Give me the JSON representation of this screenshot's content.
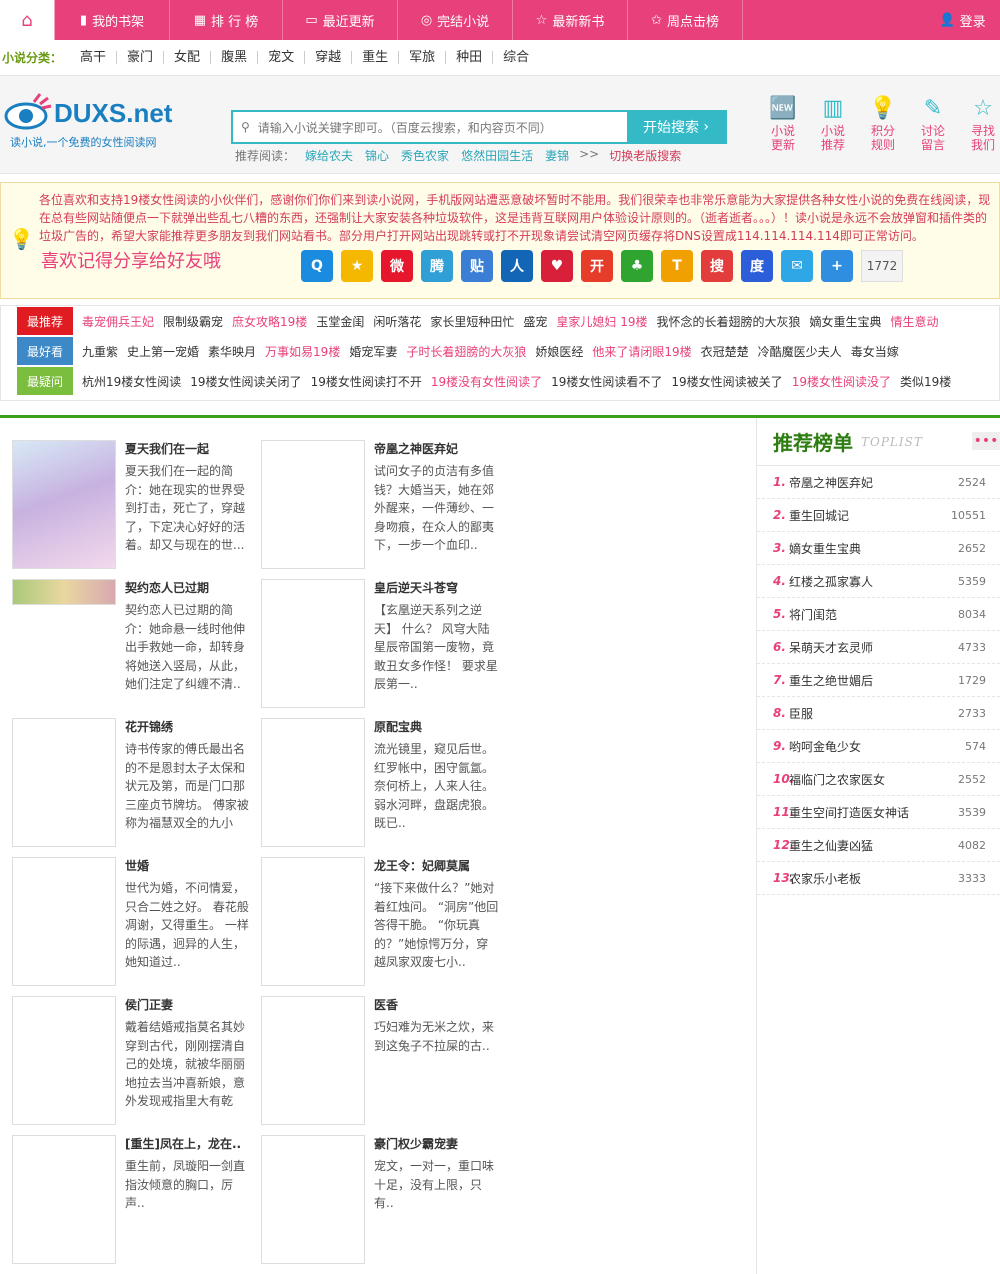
{
  "nav": {
    "home_icon": "home-icon",
    "items": [
      {
        "icon": "book-icon",
        "label": "我的书架"
      },
      {
        "icon": "list-icon",
        "label": "排 行 榜"
      },
      {
        "icon": "open-book-icon",
        "label": "最近更新"
      },
      {
        "icon": "circle-icon",
        "label": "完结小说"
      },
      {
        "icon": "star-icon",
        "label": "最新新书"
      },
      {
        "icon": "star-outline-icon",
        "label": "周点击榜"
      }
    ],
    "login": "登录"
  },
  "categories": {
    "label": "小说分类：",
    "items": [
      "高干",
      "豪门",
      "女配",
      "腹黑",
      "宠文",
      "穿越",
      "重生",
      "军旅",
      "种田",
      "综合"
    ]
  },
  "header": {
    "logo_text": "DUXS.net",
    "logo_sub": "读小说,一个免费的女性阅读网",
    "search_placeholder": "请输入小说关键字即可。（百度云搜索，和内容页不同）",
    "search_button": "开始搜索",
    "hot_label": "推荐阅读：",
    "hot": [
      "嫁给农夫",
      "锦心",
      "秀色农家",
      "悠然田园生活",
      "妻锦"
    ],
    "old_label": "切换老版搜索",
    "quick": [
      {
        "label": "小说更新",
        "icon": "new-icon"
      },
      {
        "label": "小说推荐",
        "icon": "chart-icon"
      },
      {
        "label": "积分规则",
        "icon": "bulb-icon"
      },
      {
        "label": "讨论留言",
        "icon": "pen-icon"
      },
      {
        "label": "寻找我们",
        "icon": "star-icon"
      }
    ]
  },
  "notice": {
    "text": "各位喜欢和支持19楼女性阅读的小伙伴们，感谢你们你们来到读小说网，手机版网站遭恶意破坏暂时不能用。我们很荣幸也非常乐意能为大家提供各种女性小说的免费在线阅读，现在总有些网站随便点一下就弹出些乱七八糟的东西，还强制让大家安装各种垃圾软件，这是违背互联网用户体验设计原则的。（逝者逝者。。。）！读小说是永远不会放弹窗和插件类的垃圾广告的，希望大家能推荐更多朋友到我们网站看书。部分用户打开网站出现跳转或打不开现象请尝试清空网页缓存将DNS设置成114.114.114.114即可正常访问。",
    "share_text": "喜欢记得分享给好友哦",
    "share_count": "1772"
  },
  "share_icons": [
    {
      "name": "qq-icon",
      "c": "#1b8be0",
      "g": "Q"
    },
    {
      "name": "qzone-icon",
      "c": "#f5b800",
      "g": "★"
    },
    {
      "name": "weibo-icon",
      "c": "#e6162d",
      "g": "微"
    },
    {
      "name": "tqq-icon",
      "c": "#2f9fd6",
      "g": "腾"
    },
    {
      "name": "tieba-icon",
      "c": "#3a7fd5",
      "g": "贴"
    },
    {
      "name": "renren-icon",
      "c": "#1366b6",
      "g": "人"
    },
    {
      "name": "heart-icon",
      "c": "#d8203a",
      "g": "♥"
    },
    {
      "name": "kaixin-icon",
      "c": "#e63d2a",
      "g": "开"
    },
    {
      "name": "clover-icon",
      "c": "#2fa430",
      "g": "♣"
    },
    {
      "name": "tianya-icon",
      "c": "#f0a000",
      "g": "T"
    },
    {
      "name": "sohu-icon",
      "c": "#e23c3c",
      "g": "搜"
    },
    {
      "name": "baidu-icon",
      "c": "#2d5ed9",
      "g": "度"
    },
    {
      "name": "mail-icon",
      "c": "#2fa6e6",
      "g": "✉"
    },
    {
      "name": "plus-icon",
      "c": "#2f8ee0",
      "g": "+"
    }
  ],
  "tags": [
    {
      "label": "最推荐",
      "color": "#e01c22",
      "items": [
        {
          "t": "毒宠佣兵王妃",
          "r": true
        },
        {
          "t": "限制级霸宠"
        },
        {
          "t": "庶女攻略19楼",
          "r": true
        },
        {
          "t": "玉堂金闺"
        },
        {
          "t": "闲听落花"
        },
        {
          "t": "家长里短种田忙"
        },
        {
          "t": "盛宠"
        },
        {
          "t": "皇家儿媳妇 19楼",
          "r": true
        },
        {
          "t": "我怀念的长着翅膀的大灰狼"
        },
        {
          "t": "嫡女重生宝典"
        },
        {
          "t": "情生意动",
          "r": true
        }
      ]
    },
    {
      "label": "最好看",
      "color": "#3d89c8",
      "items": [
        {
          "t": "九重紫"
        },
        {
          "t": "史上第一宠婚"
        },
        {
          "t": "素华映月"
        },
        {
          "t": "万事如易19楼",
          "r": true
        },
        {
          "t": "婚宠军妻"
        },
        {
          "t": "子时长着翅膀的大灰狼",
          "r": true
        },
        {
          "t": "娇娘医经"
        },
        {
          "t": "他来了请闭眼19楼",
          "r": true
        },
        {
          "t": "衣冠楚楚"
        },
        {
          "t": "冷酷魔医少夫人"
        },
        {
          "t": "毒女当嫁"
        }
      ]
    },
    {
      "label": "最疑问",
      "color": "#7bbd3c",
      "items": [
        {
          "t": "杭州19楼女性阅读"
        },
        {
          "t": "19楼女性阅读关闭了"
        },
        {
          "t": "19楼女性阅读打不开"
        },
        {
          "t": "19楼没有女性阅读了",
          "r": true
        },
        {
          "t": "19楼女性阅读看不了"
        },
        {
          "t": "19楼女性阅读被关了"
        },
        {
          "t": "19楼女性阅读没了",
          "r": true
        },
        {
          "t": "类似19楼"
        }
      ]
    }
  ],
  "books": [
    {
      "title": "夏天我们在一起",
      "desc": "夏天我们在一起的简介：她在现实的世界受到打击，死亡了，穿越了，下定决心好好的活着。却又与现在的世..."
    },
    {
      "title": "帝凰之神医弃妃",
      "desc": "试问女子的贞洁有多值钱？大婚当天，她在郊外醒来，一件薄纱、一身吻痕，在众人的鄙夷下，一步一个血印.."
    },
    {
      "title": "契约恋人已过期",
      "desc": "契约恋人已过期的简介：她命悬一线时他伸出手救她一命，却转身将她送入竖局，从此，她们注定了纠缠不清.."
    },
    {
      "title": "皇后逆天斗苍穹",
      "desc": "【玄凰逆天系列之逆天】 什么？ 风穹大陆星辰帝国第一废物，竟敢丑女多作怪！ 要求星辰第一.."
    },
    {
      "title": "花开锦绣",
      "desc": "诗书传家的傅氏最出名的不是恩封太子太保和状元及第，而是门口那三座贞节牌坊。 傅家被称为福慧双全的九小姐.."
    },
    {
      "title": "原配宝典",
      "desc": "流光镜里，窥见后世。红罗帐中，困守氤氲。奈何桥上，人来人往。弱水河畔，盘踞虎狼。既已.."
    },
    {
      "title": "世婚",
      "desc": "世代为婚，不问情爱，只合二姓之好。 春花般凋谢，又得重生。 一样的际遇，迥异的人生，她知道过.."
    },
    {
      "title": "龙王令：妃卿莫属",
      "desc": "“接下来做什么？”她对着红烛问。 “洞房”他回答得干脆。 “你玩真的？”她惊愕万分，穿越凤家双废七小.."
    },
    {
      "title": "侯门正妻",
      "desc": "戴着结婚戒指莫名其妙穿到古代，刚刚摆清自己的处境，就被华丽丽地拉去当冲喜新娘，意外发现戒指里大有乾坤.."
    },
    {
      "title": "医香",
      "desc": "巧妇难为无米之炊，来到这兔子不拉屎的古.."
    },
    {
      "title": "[重生]凤在上，龙在..",
      "desc": "重生前，凤璇阳一剑直指汝倾意的胸口，厉声.."
    },
    {
      "title": "豪门权少霸宠妻",
      "desc": "宠文，一对一，重口味十足，没有上限，只有.."
    }
  ],
  "ranking": {
    "title": "推荐榜单",
    "sub": "TOPLIST",
    "more": "•••",
    "items": [
      {
        "n": "1.",
        "t": "帝凰之神医弃妃",
        "v": "2524"
      },
      {
        "n": "2.",
        "t": "重生回城记",
        "v": "10551"
      },
      {
        "n": "3.",
        "t": "嫡女重生宝典",
        "v": "2652"
      },
      {
        "n": "4.",
        "t": "红楼之孤家寡人",
        "v": "5359"
      },
      {
        "n": "5.",
        "t": "将门闺范",
        "v": "8034"
      },
      {
        "n": "6.",
        "t": "呆萌天才玄灵师",
        "v": "4733"
      },
      {
        "n": "7.",
        "t": "重生之绝世媚后",
        "v": "1729"
      },
      {
        "n": "8.",
        "t": "臣服",
        "v": "2733"
      },
      {
        "n": "9.",
        "t": "哟呵金龟少女",
        "v": "574"
      },
      {
        "n": "10.",
        "t": "福临门之农家医女",
        "v": "2552"
      },
      {
        "n": "11.",
        "t": "重生空间打造医女神话",
        "v": "3539"
      },
      {
        "n": "12.",
        "t": "重生之仙妻凶猛",
        "v": "4082"
      },
      {
        "n": "13.",
        "t": "农家乐小老板",
        "v": "3333"
      }
    ]
  }
}
